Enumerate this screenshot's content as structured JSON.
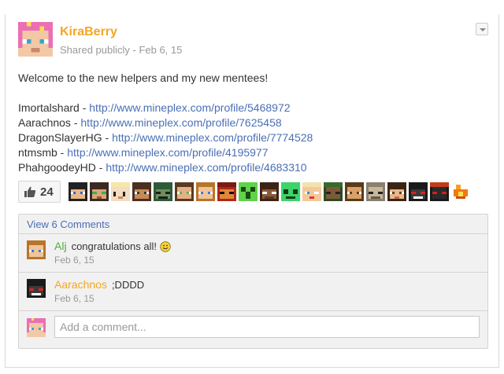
{
  "post": {
    "author": "KiraBerry",
    "meta": "Shared publicly - Feb 6, 15",
    "intro": "Welcome to the new helpers and my new mentees!",
    "links": [
      {
        "name": "Imortalshard",
        "sep": " - ",
        "url": "http://www.mineplex.com/profile/5468972"
      },
      {
        "name": "Aarachnos",
        "sep": " - ",
        "url": "http://www.mineplex.com/profile/7625458"
      },
      {
        "name": "DragonSlayerHG",
        "sep": " - ",
        "url": "http://www.mineplex.com/profile/7774528"
      },
      {
        "name": "ntmsmb",
        "sep": " - ",
        "url": "http://www.mineplex.com/profile/4195977"
      },
      {
        "name": "PhahgoodeyHD",
        "sep": " - ",
        "url": "http://www.mineplex.com/profile/4683310"
      }
    ],
    "plus_count": "24"
  },
  "comments": {
    "view_label": "View 6 Comments",
    "items": [
      {
        "author": "Alj",
        "text": "congratulations all!",
        "date": "Feb 6, 15"
      },
      {
        "author": "Aarachnos",
        "text": ";DDDD",
        "date": "Feb 6, 15"
      }
    ],
    "add_placeholder": "Add a comment..."
  },
  "colors": {
    "author": "#f5a623",
    "link": "#4a6fb5",
    "comment_green": "#4caf3a",
    "comment_orange": "#f5a623"
  }
}
